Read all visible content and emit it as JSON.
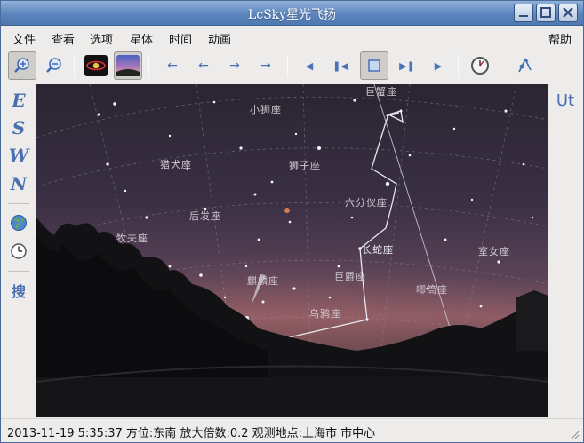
{
  "window": {
    "title": "LcSky星光飞扬"
  },
  "menu": {
    "file": "文件",
    "view": "查看",
    "options": "选项",
    "objects": "星体",
    "time": "时间",
    "animation": "动画",
    "help": "帮助"
  },
  "leftbar": {
    "east": "E",
    "south": "S",
    "west": "W",
    "north": "N",
    "search": "搜"
  },
  "rightbar": {
    "ut": "Ut"
  },
  "constellations": {
    "c1": "巨蟹座",
    "c2": "小狮座",
    "c3": "猎犬座",
    "c4": "狮子座",
    "c5": "后发座",
    "c6": "六分仪座",
    "c7": "长蛇座",
    "c8": "巨爵座",
    "c9": "室女座",
    "c10": "乌鸦座",
    "c11": "麒麟座",
    "c12": "唧筒座",
    "c13": "牧夫座"
  },
  "status": {
    "text": "2013-11-19 5:35:37 方位:东南 放大倍数:0.2 观测地点:上海市 市中心"
  },
  "colors": {
    "accent": "#4a73b8",
    "titlebar": "#5d85bd"
  }
}
